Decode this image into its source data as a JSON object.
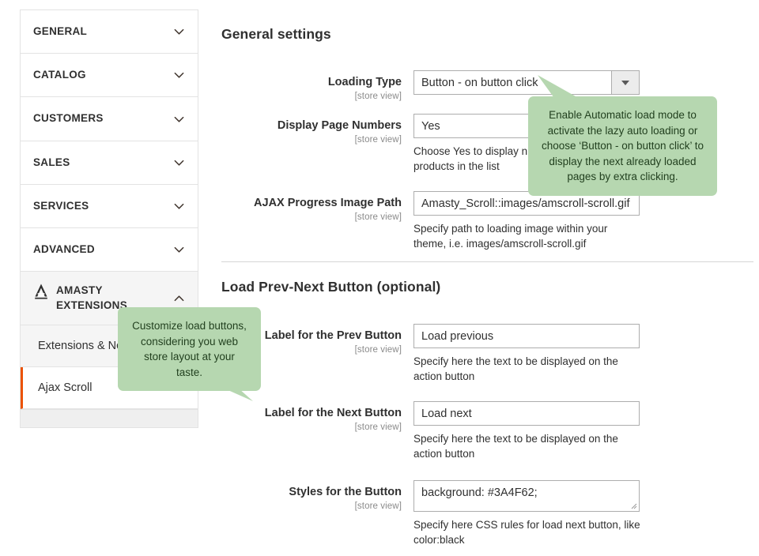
{
  "sidebar": {
    "sections": [
      {
        "label": "GENERAL",
        "icon": "chevron-down-icon",
        "expanded": false
      },
      {
        "label": "CATALOG",
        "icon": "chevron-down-icon",
        "expanded": false
      },
      {
        "label": "CUSTOMERS",
        "icon": "chevron-down-icon",
        "expanded": false
      },
      {
        "label": "SALES",
        "icon": "chevron-down-icon",
        "expanded": false
      },
      {
        "label": "SERVICES",
        "icon": "chevron-down-icon",
        "expanded": false
      },
      {
        "label": "ADVANCED",
        "icon": "chevron-down-icon",
        "expanded": false
      }
    ],
    "amasty": {
      "label": "AMASTY EXTENSIONS",
      "logo_icon": "amasty-a-logo-icon",
      "chevron_icon": "chevron-up-icon",
      "expanded": true
    },
    "sub_items": [
      {
        "label": "Extensions & Notifications",
        "active": false
      },
      {
        "label": "Ajax Scroll",
        "active": true
      }
    ],
    "active_accent_color": "#eb5202"
  },
  "main": {
    "general_section": {
      "heading": "General settings",
      "fields": [
        {
          "label": "Loading Type",
          "scope": "[store view]",
          "type": "select",
          "value": "Button - on button click",
          "note": ""
        },
        {
          "label": "Display Page Numbers",
          "scope": "[store view]",
          "type": "select",
          "value": "Yes",
          "note": "Choose Yes to display numbers above loaded products in the list"
        },
        {
          "label": "AJAX Progress Image Path",
          "scope": "[store view]",
          "type": "text",
          "value": "Amasty_Scroll::images/amscroll-scroll.gif",
          "note": "Specify path to loading image within your theme, i.e. images/amscroll-scroll.gif"
        }
      ]
    },
    "prevnext_section": {
      "heading": "Load Prev-Next Button (optional)",
      "fields": [
        {
          "label": "Label for the Prev Button",
          "scope": "[store view]",
          "type": "text",
          "value": "Load previous",
          "note": "Specify here the text to be displayed on the action button"
        },
        {
          "label": "Label for the Next Button",
          "scope": "[store view]",
          "type": "text",
          "value": "Load next",
          "note": "Specify here the text to be displayed on the action button"
        },
        {
          "label": "Styles for the Button",
          "scope": "[store view]",
          "type": "textarea",
          "value": "background: #3A4F62;",
          "note": "Specify here CSS rules for load next button, like color:black"
        }
      ]
    }
  },
  "tooltips": {
    "loading_type": "Enable Automatic load mode to activate the lazy auto loading or choose ‘Button - on button click’ to display the next already loaded pages by extra clicking.",
    "load_buttons": "Customize load buttons, considering you web store layout at your taste.",
    "background_color": "#b6d7b0",
    "text_color": "#22401f"
  }
}
